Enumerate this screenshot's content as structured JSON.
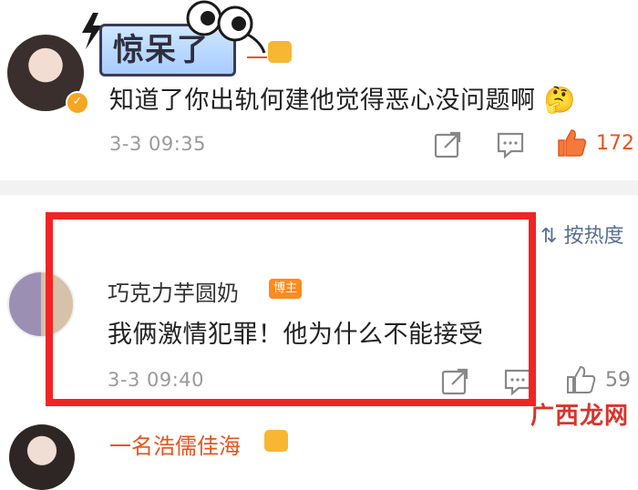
{
  "sticker": {
    "text": "惊呆了"
  },
  "comment1": {
    "username_partial": "一",
    "content": "知道了你出轨何建他觉得恶心没问题啊",
    "emoji": "🤔",
    "time": "3-3 09:35",
    "likes": "172"
  },
  "sort": {
    "label": "按热度"
  },
  "comment2": {
    "username": "巧克力芋圆奶",
    "badge": "博主",
    "content": "我俩激情犯罪！他为什么不能接受",
    "time": "3-3 09:40",
    "likes": "59"
  },
  "comment3": {
    "username_partial": "一名浩儒佳海"
  },
  "watermark": {
    "text": "广西龙网"
  },
  "colors": {
    "highlight_frame": "#f12424",
    "liked": "#e8541e",
    "blogger_badge": "#ff8a1f"
  }
}
